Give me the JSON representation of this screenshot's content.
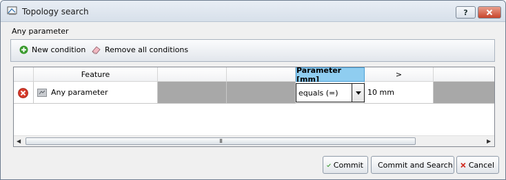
{
  "window": {
    "title": "Topology search",
    "subtitle": "Any parameter",
    "help_label": "?"
  },
  "toolbar": {
    "new_condition_label": "New condition",
    "remove_all_label": "Remove all conditions"
  },
  "grid": {
    "headers": {
      "feature": "Feature",
      "parameter": "Parameter [mm]",
      "next": ">"
    },
    "row": {
      "feature_value": "Any parameter",
      "operator_value": "equals (=)",
      "parameter_value": "10 mm"
    },
    "scrollbar_grip": "III"
  },
  "buttons": {
    "commit_label": "Commit",
    "commit_search_label": "Commit and Search",
    "cancel_label": "Cancel"
  },
  "colors": {
    "active_header": "#8fcdf0",
    "disabled_cell": "#a8a8a8",
    "close_button": "#c8442a"
  }
}
